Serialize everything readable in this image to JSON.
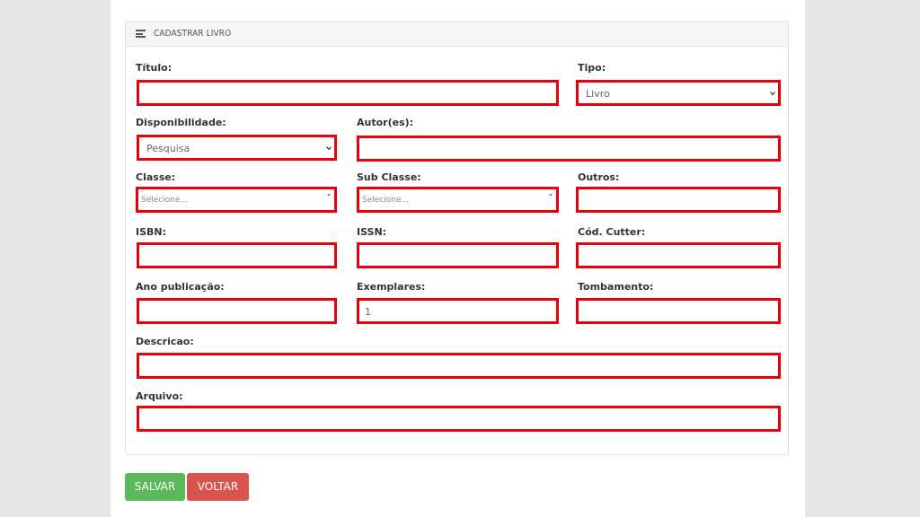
{
  "panel": {
    "title": "CADASTRAR LIVRO"
  },
  "fields": {
    "titulo": {
      "label": "Título:",
      "value": ""
    },
    "tipo": {
      "label": "Tipo:",
      "value": "Livro"
    },
    "disponibilidade": {
      "label": "Disponibilidade:",
      "value": "Pesquisa"
    },
    "autores": {
      "label": "Autor(es):",
      "value": ""
    },
    "classe": {
      "label": "Classe:",
      "placeholder": "Selecione..."
    },
    "subclasse": {
      "label": "Sub Classe:",
      "placeholder": "Selecione..."
    },
    "outros": {
      "label": "Outros:",
      "value": ""
    },
    "isbn": {
      "label": "ISBN:",
      "value": ""
    },
    "issn": {
      "label": "ISSN:",
      "value": ""
    },
    "cutter": {
      "label": "Cód. Cutter:",
      "value": ""
    },
    "ano": {
      "label": "Ano publicação:",
      "value": ""
    },
    "exemplares": {
      "label": "Exemplares:",
      "value": "1"
    },
    "tombamento": {
      "label": "Tombamento:",
      "value": ""
    },
    "descricao": {
      "label": "Descricao:",
      "value": ""
    },
    "arquivo": {
      "label": "Arquivo:",
      "value": ""
    }
  },
  "actions": {
    "save_label": "SALVAR",
    "back_label": "VOLTAR"
  },
  "colors": {
    "highlight_border": "#e8000b",
    "save": "#5cb85c",
    "back": "#d9534f",
    "background": "#e5e5e5"
  }
}
